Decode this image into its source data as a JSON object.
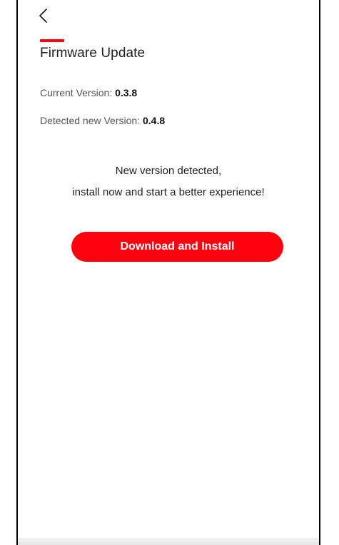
{
  "header": {
    "back_icon": "chevron-left-icon",
    "title": "Firmware Update",
    "accent_color": "#ff000f"
  },
  "versions": {
    "current_label": "Current Version: ",
    "current_value": "0.3.8",
    "new_label": "Detected new Version: ",
    "new_value": "0.4.8"
  },
  "message": {
    "line1": "New version detected,",
    "line2": "install now and start a better experience!"
  },
  "actions": {
    "download_label": "Download and Install",
    "button_color": "#ff000f"
  }
}
